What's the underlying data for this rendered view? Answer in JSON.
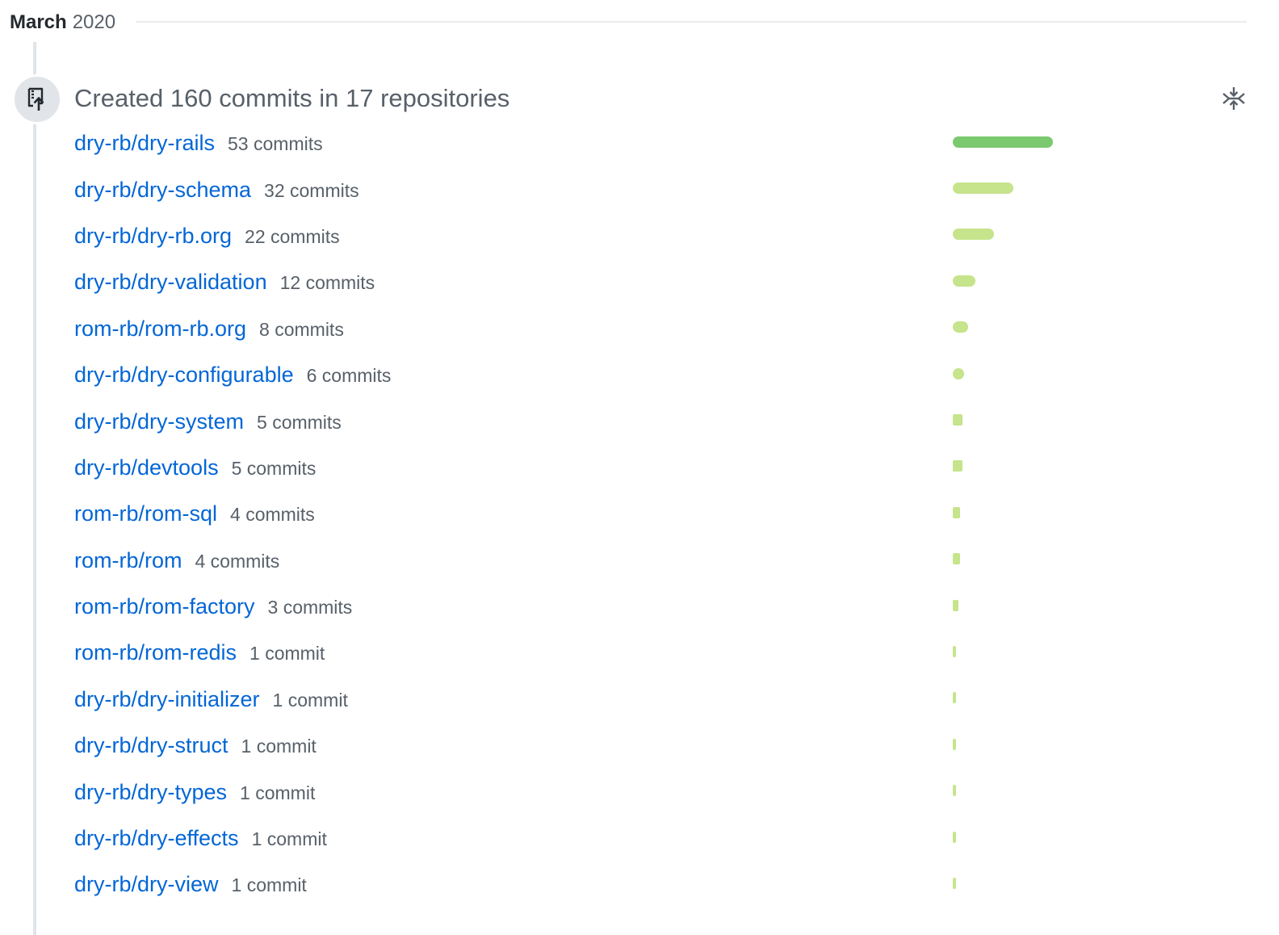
{
  "header": {
    "month": "March",
    "year": "2020"
  },
  "event": {
    "icon": "repo-push-icon",
    "title": "Created 160 commits in 17 repositories",
    "collapse_icon": "fold-icon"
  },
  "colors": {
    "link": "#0366d6",
    "muted": "#586069",
    "bar_top": "#7bc96f",
    "bar_other": "#c6e48b"
  },
  "repos": [
    {
      "name": "dry-rb/dry-rails",
      "count_label": "53 commits",
      "commits": 53
    },
    {
      "name": "dry-rb/dry-schema",
      "count_label": "32 commits",
      "commits": 32
    },
    {
      "name": "dry-rb/dry-rb.org",
      "count_label": "22 commits",
      "commits": 22
    },
    {
      "name": "dry-rb/dry-validation",
      "count_label": "12 commits",
      "commits": 12
    },
    {
      "name": "rom-rb/rom-rb.org",
      "count_label": "8 commits",
      "commits": 8
    },
    {
      "name": "dry-rb/dry-configurable",
      "count_label": "6 commits",
      "commits": 6
    },
    {
      "name": "dry-rb/dry-system",
      "count_label": "5 commits",
      "commits": 5
    },
    {
      "name": "dry-rb/devtools",
      "count_label": "5 commits",
      "commits": 5
    },
    {
      "name": "rom-rb/rom-sql",
      "count_label": "4 commits",
      "commits": 4
    },
    {
      "name": "rom-rb/rom",
      "count_label": "4 commits",
      "commits": 4
    },
    {
      "name": "rom-rb/rom-factory",
      "count_label": "3 commits",
      "commits": 3
    },
    {
      "name": "rom-rb/rom-redis",
      "count_label": "1 commit",
      "commits": 1
    },
    {
      "name": "dry-rb/dry-initializer",
      "count_label": "1 commit",
      "commits": 1
    },
    {
      "name": "dry-rb/dry-struct",
      "count_label": "1 commit",
      "commits": 1
    },
    {
      "name": "dry-rb/dry-types",
      "count_label": "1 commit",
      "commits": 1
    },
    {
      "name": "dry-rb/dry-effects",
      "count_label": "1 commit",
      "commits": 1
    },
    {
      "name": "dry-rb/dry-view",
      "count_label": "1 commit",
      "commits": 1
    }
  ]
}
